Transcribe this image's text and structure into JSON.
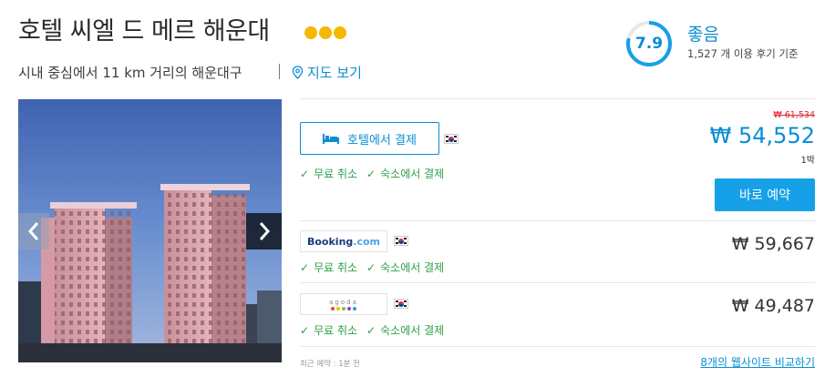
{
  "hotel": {
    "name": "호텔 씨엘 드 메르 해운대",
    "star_count": 3,
    "star_color": "#f5b800",
    "location_text": "시내 중심에서 11 km 거리의 해운대구",
    "map_link": "지도 보기"
  },
  "rating": {
    "score": "7.9",
    "score_fraction": 0.79,
    "label": "좋음",
    "reviews": "1,527 개 이용 후기 기준",
    "accent_color": "#0a8ed4"
  },
  "photo": {
    "prev_icon": "chevron-left-icon",
    "next_icon": "chevron-right-icon"
  },
  "offers": {
    "featured": {
      "button_label": "호텔에서 결제",
      "button_icon": "bed-icon",
      "flag": "kr-flag-icon",
      "benefits": [
        "무료 취소",
        "숙소에서 결제"
      ],
      "old_price": "₩ 61,534",
      "price": "₩ 54,552",
      "per_night": "1박",
      "book_label": "바로 예약"
    },
    "partners": [
      {
        "provider": "Booking.com",
        "provider_name": "Booking",
        "provider_suffix": ".com",
        "flag": "kr-flag-icon",
        "benefits": [
          "무료 취소",
          "숙소에서 결제"
        ],
        "price": "₩ 59,667"
      },
      {
        "provider": "agoda",
        "flag": "kr-flag-icon",
        "benefits": [
          "무료 취소",
          "숙소에서 결제"
        ],
        "price": "₩ 49,487"
      }
    ]
  },
  "footer": {
    "recent_booking": "최근 예약 : 1분 전",
    "compare_link": "8개의 웹사이트 비교하기"
  },
  "colors": {
    "benefit_green": "#2e9e46",
    "book_button": "#16a0e8",
    "old_price_red": "#dd2233"
  }
}
